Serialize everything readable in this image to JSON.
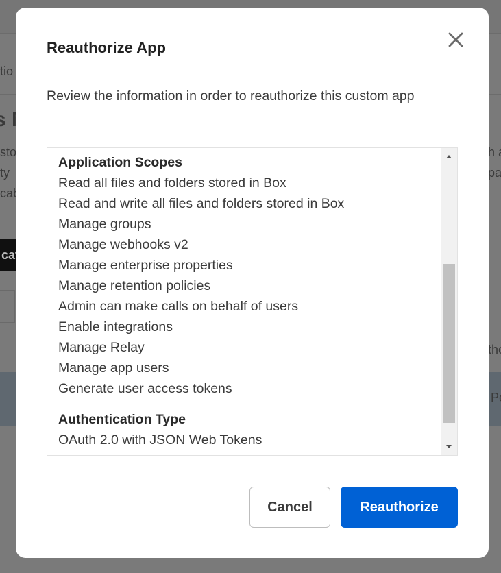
{
  "background_page": {
    "fragments": [
      "tio",
      "s M",
      "sto",
      "ty",
      "cab",
      "cat",
      "h a",
      "par",
      "tho",
      "Pe"
    ]
  },
  "modal": {
    "title": "Reauthorize App",
    "description": "Review the information in order to reauthorize this custom app",
    "close_icon": "close-icon",
    "scopes_heading": "Application Scopes",
    "scopes": [
      "Read all files and folders stored in Box",
      "Read and write all files and folders stored in Box",
      "Manage groups",
      "Manage webhooks v2",
      "Manage enterprise properties",
      "Manage retention policies",
      "Admin can make calls on behalf of users",
      "Enable integrations",
      "Manage Relay",
      "Manage app users",
      "Generate user access tokens"
    ],
    "auth_heading": "Authentication Type",
    "auth_value": "OAuth 2.0 with JSON Web Tokens",
    "cancel_label": "Cancel",
    "confirm_label": "Reauthorize"
  },
  "colors": {
    "primary": "#0061d5",
    "overlay": "#4a4a4a"
  }
}
